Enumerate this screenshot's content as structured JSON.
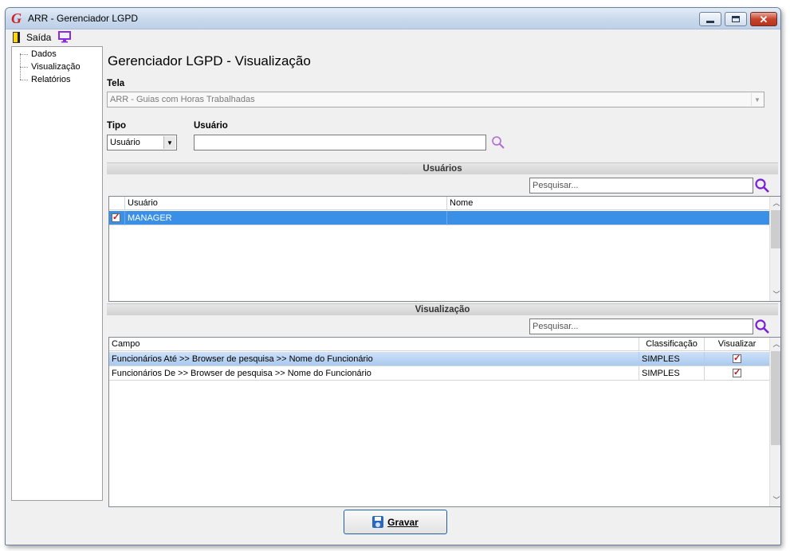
{
  "window": {
    "title": "ARR - Gerenciador LGPD",
    "logo_letter": "G",
    "close_glyph": "✕"
  },
  "toolbar": {
    "exit_label": "Saída"
  },
  "sidebar": {
    "items": [
      {
        "label": "Dados"
      },
      {
        "label": "Visualização"
      },
      {
        "label": "Relatórios"
      }
    ]
  },
  "main": {
    "title": "Gerenciador LGPD - Visualização",
    "tela_label": "Tela",
    "tela_value": "ARR - Guias com Horas Trabalhadas",
    "tipo_label": "Tipo",
    "tipo_value": "Usuário",
    "usuario_label": "Usuário",
    "usuario_value": ""
  },
  "usuarios_section": {
    "title": "Usuários",
    "search_placeholder": "Pesquisar...",
    "columns": [
      "Usuário",
      "Nome"
    ],
    "rows": [
      {
        "checked": true,
        "usuario": "MANAGER",
        "nome": ""
      }
    ]
  },
  "visualizacao_section": {
    "title": "Visualização",
    "search_placeholder": "Pesquisar...",
    "columns": [
      "Campo",
      "Classificação",
      "Visualizar"
    ],
    "rows": [
      {
        "campo": "Funcionários Até >> Browser de pesquisa >> Nome do Funcionário",
        "classificacao": "SIMPLES",
        "visualizar": true
      },
      {
        "campo": "Funcionários De >> Browser de pesquisa >> Nome do Funcionário",
        "classificacao": "SIMPLES",
        "visualizar": true
      }
    ]
  },
  "footer": {
    "save_label": "Gravar"
  },
  "colors": {
    "selection": "#3a8fe6",
    "accent_purple": "#8a2be2",
    "check_red": "#c8141e"
  },
  "icons": [
    "app-logo-icon",
    "exit-door-icon",
    "monitor-icon",
    "search-icon",
    "floppy-disk-icon"
  ]
}
